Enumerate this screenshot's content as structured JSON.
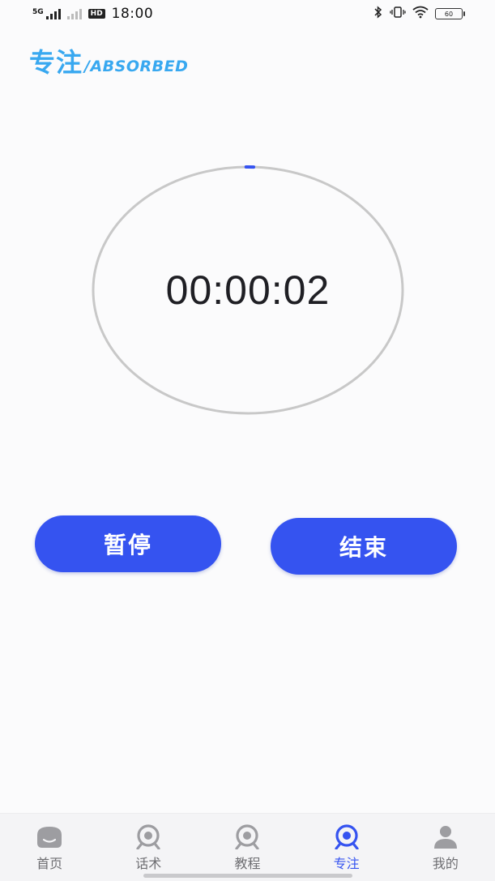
{
  "status_bar": {
    "network_tag": "5G",
    "hd_tag": "HD",
    "time": "18:00",
    "battery": "60",
    "icons": [
      "bluetooth-icon",
      "vibrate-icon",
      "wifi-icon",
      "battery-icon"
    ]
  },
  "header": {
    "title_cn": "专注",
    "title_en": "/ABSORBED",
    "color": "#38a8f0"
  },
  "timer": {
    "display": "00:00:02",
    "ring_color": "#c8c8c8",
    "progress_color": "#3553f0",
    "progress_fraction": 0.002
  },
  "actions": {
    "pause_label": "暂停",
    "end_label": "结束",
    "accent": "#3553f0"
  },
  "tabbar": {
    "items": [
      {
        "label": "首页",
        "icon": "home-face-icon",
        "active": false
      },
      {
        "label": "话术",
        "icon": "robot-icon",
        "active": false
      },
      {
        "label": "教程",
        "icon": "robot-icon",
        "active": false
      },
      {
        "label": "专注",
        "icon": "robot-icon",
        "active": true
      },
      {
        "label": "我的",
        "icon": "person-icon",
        "active": false
      }
    ]
  }
}
